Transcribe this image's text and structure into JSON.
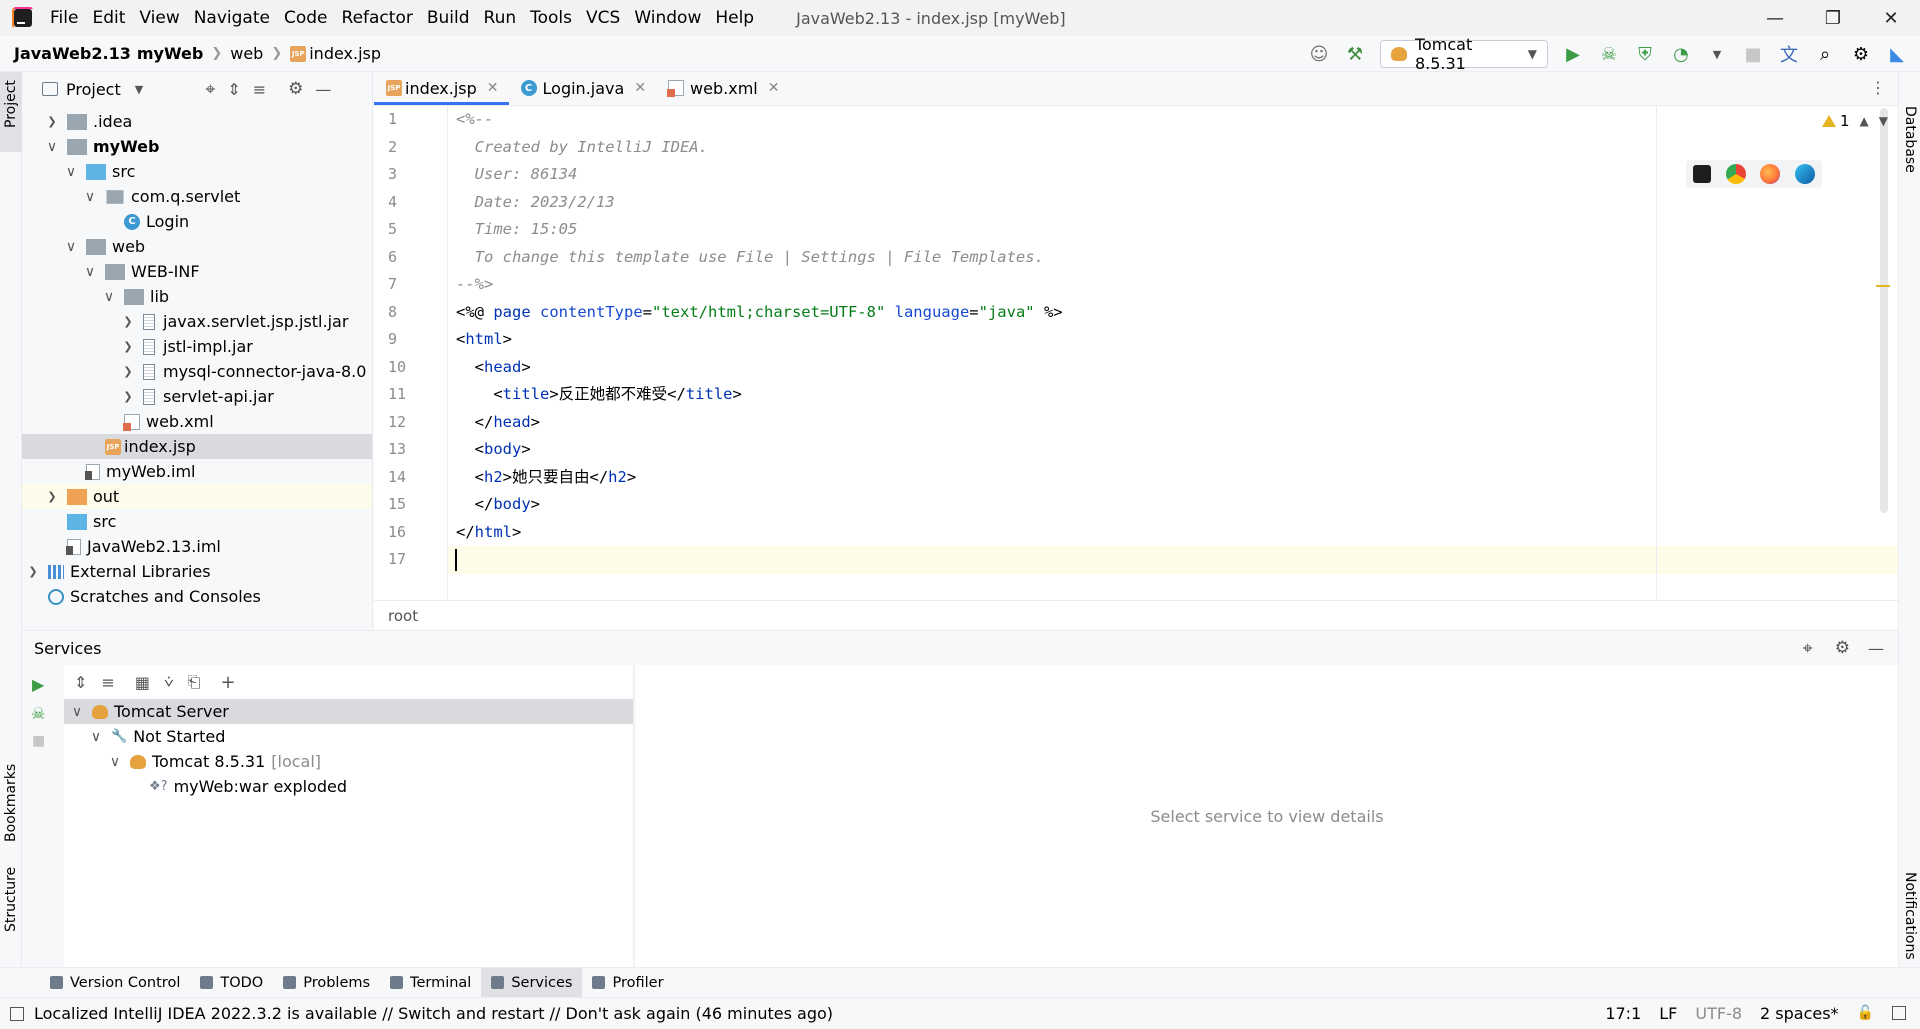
{
  "menubar": {
    "items": [
      "File",
      "Edit",
      "View",
      "Navigate",
      "Code",
      "Refactor",
      "Build",
      "Run",
      "Tools",
      "VCS",
      "Window",
      "Help"
    ],
    "window_title": "JavaWeb2.13 - index.jsp [myWeb]"
  },
  "navbar": {
    "crumbs": [
      "JavaWeb2.13",
      "myWeb",
      "web",
      "index.jsp"
    ],
    "run_config": "Tomcat 8.5.31"
  },
  "project": {
    "header": "Project",
    "tree": [
      {
        "label": ".idea",
        "indent": 1,
        "chev": ">",
        "icon": "folder-gray"
      },
      {
        "label": "myWeb",
        "indent": 1,
        "chev": "v",
        "icon": "folder-module",
        "bold": true
      },
      {
        "label": "src",
        "indent": 2,
        "chev": "v",
        "icon": "folder-blue"
      },
      {
        "label": "com.q.servlet",
        "indent": 3,
        "chev": "v",
        "icon": "folder-package"
      },
      {
        "label": "Login",
        "indent": 4,
        "chev": "",
        "icon": "class"
      },
      {
        "label": "web",
        "indent": 2,
        "chev": "v",
        "icon": "folder-web"
      },
      {
        "label": "WEB-INF",
        "indent": 3,
        "chev": "v",
        "icon": "folder-gray"
      },
      {
        "label": "lib",
        "indent": 4,
        "chev": "v",
        "icon": "folder-gray"
      },
      {
        "label": "javax.servlet.jsp.jstl.jar",
        "indent": 5,
        "chev": ">",
        "icon": "jar"
      },
      {
        "label": "jstl-impl.jar",
        "indent": 5,
        "chev": ">",
        "icon": "jar"
      },
      {
        "label": "mysql-connector-java-8.0",
        "indent": 5,
        "chev": ">",
        "icon": "jar"
      },
      {
        "label": "servlet-api.jar",
        "indent": 5,
        "chev": ">",
        "icon": "jar"
      },
      {
        "label": "web.xml",
        "indent": 4,
        "chev": "",
        "icon": "xml"
      },
      {
        "label": "index.jsp",
        "indent": 3,
        "chev": "",
        "icon": "jsp",
        "selected": true
      },
      {
        "label": "myWeb.iml",
        "indent": 2,
        "chev": "",
        "icon": "iml"
      },
      {
        "label": "out",
        "indent": 1,
        "chev": ">",
        "icon": "folder-orange",
        "highlight": true
      },
      {
        "label": "src",
        "indent": 1,
        "chev": "",
        "icon": "folder-blue"
      },
      {
        "label": "JavaWeb2.13.iml",
        "indent": 1,
        "chev": "",
        "icon": "iml"
      },
      {
        "label": "External Libraries",
        "indent": 0,
        "chev": ">",
        "icon": "libraries"
      },
      {
        "label": "Scratches and Consoles",
        "indent": 0,
        "chev": "",
        "icon": "scratches"
      }
    ]
  },
  "editor": {
    "tabs": [
      {
        "label": "index.jsp",
        "icon": "jsp",
        "active": true
      },
      {
        "label": "Login.java",
        "icon": "class",
        "active": false
      },
      {
        "label": "web.xml",
        "icon": "xml",
        "active": false
      }
    ],
    "line_numbers": [
      "1",
      "2",
      "3",
      "4",
      "5",
      "6",
      "7",
      "8",
      "9",
      "10",
      "11",
      "12",
      "13",
      "14",
      "15",
      "16",
      "17"
    ],
    "lines": [
      [
        {
          "t": "<%--",
          "c": "cmt"
        }
      ],
      [
        {
          "t": "  Created by IntelliJ IDEA.",
          "c": "cmt"
        }
      ],
      [
        {
          "t": "  User: 86134",
          "c": "cmt"
        }
      ],
      [
        {
          "t": "  Date: 2023/2/13",
          "c": "cmt"
        }
      ],
      [
        {
          "t": "  Time: 15:05",
          "c": "cmt"
        }
      ],
      [
        {
          "t": "  To change this template use File | Settings | File Templates.",
          "c": "cmt"
        }
      ],
      [
        {
          "t": "--%>",
          "c": "cmt"
        }
      ],
      [
        {
          "t": "<%@ ",
          "c": "dir"
        },
        {
          "t": "page ",
          "c": "tag"
        },
        {
          "t": "contentType",
          "c": "attr"
        },
        {
          "t": "=",
          "c": "dir"
        },
        {
          "t": "\"text/html;charset=UTF-8\"",
          "c": "str"
        },
        {
          "t": " ",
          "c": "dir"
        },
        {
          "t": "language",
          "c": "attr"
        },
        {
          "t": "=",
          "c": "dir"
        },
        {
          "t": "\"java\"",
          "c": "str"
        },
        {
          "t": " %>",
          "c": "dir"
        }
      ],
      [
        {
          "t": "<",
          "c": "dir"
        },
        {
          "t": "html",
          "c": "tag"
        },
        {
          "t": ">",
          "c": "dir"
        }
      ],
      [
        {
          "t": "  <",
          "c": "dir"
        },
        {
          "t": "head",
          "c": "tag"
        },
        {
          "t": ">",
          "c": "dir"
        }
      ],
      [
        {
          "t": "    <",
          "c": "dir"
        },
        {
          "t": "title",
          "c": "tag"
        },
        {
          "t": ">反正她都不难受</",
          "c": "dir"
        },
        {
          "t": "title",
          "c": "tag"
        },
        {
          "t": ">",
          "c": "dir"
        }
      ],
      [
        {
          "t": "  </",
          "c": "dir"
        },
        {
          "t": "head",
          "c": "tag"
        },
        {
          "t": ">",
          "c": "dir"
        }
      ],
      [
        {
          "t": "  <",
          "c": "dir"
        },
        {
          "t": "body",
          "c": "tag"
        },
        {
          "t": ">",
          "c": "dir"
        }
      ],
      [
        {
          "t": "  <",
          "c": "dir"
        },
        {
          "t": "h2",
          "c": "tag"
        },
        {
          "t": ">她只要自由</",
          "c": "dir"
        },
        {
          "t": "h2",
          "c": "tag"
        },
        {
          "t": ">",
          "c": "dir"
        }
      ],
      [
        {
          "t": "  </",
          "c": "dir"
        },
        {
          "t": "body",
          "c": "tag"
        },
        {
          "t": ">",
          "c": "dir"
        }
      ],
      [
        {
          "t": "</",
          "c": "dir"
        },
        {
          "t": "html",
          "c": "tag"
        },
        {
          "t": ">",
          "c": "dir"
        }
      ],
      [
        {
          "t": "",
          "c": "dir"
        }
      ]
    ],
    "warnings_count": "1",
    "breadcrumb": "root"
  },
  "services": {
    "title": "Services",
    "tree": [
      {
        "label": "Tomcat Server",
        "indent": 0,
        "chev": "v",
        "icon": "tomcat",
        "selected": true
      },
      {
        "label": "Not Started",
        "indent": 1,
        "chev": "v",
        "icon": "wrench"
      },
      {
        "label": "Tomcat 8.5.31",
        "suffix": "[local]",
        "indent": 2,
        "chev": "v",
        "icon": "tomcat"
      },
      {
        "label": "myWeb:war exploded",
        "indent": 3,
        "chev": "",
        "icon": "artifact"
      }
    ],
    "detail_placeholder": "Select service to view details"
  },
  "side_labels": {
    "project": "Project",
    "bookmarks": "Bookmarks",
    "structure": "Structure",
    "database": "Database",
    "notifications": "Notifications"
  },
  "tooltabs": [
    "Version Control",
    "TODO",
    "Problems",
    "Terminal",
    "Services",
    "Profiler"
  ],
  "tooltabs_active": "Services",
  "status": {
    "message": "Localized IntelliJ IDEA 2022.3.2 is available // Switch and restart // Don't ask again (46 minutes ago)",
    "position": "17:1",
    "line_sep": "LF",
    "encoding": "UTF-8",
    "indent": "2 spaces*"
  }
}
